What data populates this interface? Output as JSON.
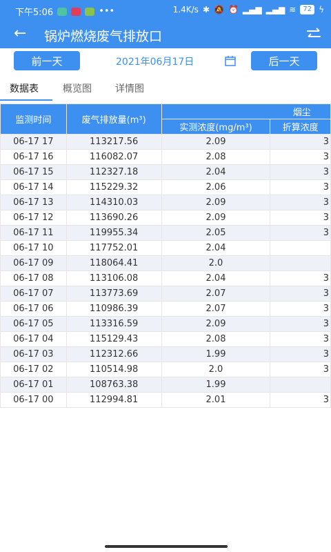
{
  "status": {
    "time": "下午5:06",
    "dots": "•••",
    "speed": "1.4K/s",
    "battery": "72"
  },
  "appbar": {
    "title": "锅炉燃烧废气排放口"
  },
  "datebar": {
    "prev": "前一天",
    "date": "2021年06月17日",
    "next": "后一天"
  },
  "tabs": [
    "数据表",
    "概览图",
    "详情图"
  ],
  "table": {
    "h_time": "监测时间",
    "h_flow": "废气排放量(m³)",
    "h_group": "烟尘",
    "h_measured": "实测浓度(mg/m³)",
    "h_converted": "折算浓度",
    "rows": [
      {
        "time": "06-17 17",
        "flow": "113217.56",
        "measured": "2.09",
        "conv": "3"
      },
      {
        "time": "06-17 16",
        "flow": "116082.07",
        "measured": "2.08",
        "conv": "3"
      },
      {
        "time": "06-17 15",
        "flow": "112327.18",
        "measured": "2.04",
        "conv": "3"
      },
      {
        "time": "06-17 14",
        "flow": "115229.32",
        "measured": "2.06",
        "conv": "3"
      },
      {
        "time": "06-17 13",
        "flow": "114310.03",
        "measured": "2.09",
        "conv": "3"
      },
      {
        "time": "06-17 12",
        "flow": "113690.26",
        "measured": "2.09",
        "conv": "3"
      },
      {
        "time": "06-17 11",
        "flow": "119955.34",
        "measured": "2.05",
        "conv": "3"
      },
      {
        "time": "06-17 10",
        "flow": "117752.01",
        "measured": "2.04",
        "conv": ""
      },
      {
        "time": "06-17 09",
        "flow": "118064.41",
        "measured": "2.0",
        "conv": ""
      },
      {
        "time": "06-17 08",
        "flow": "113106.08",
        "measured": "2.04",
        "conv": "3"
      },
      {
        "time": "06-17 07",
        "flow": "113773.69",
        "measured": "2.07",
        "conv": "3"
      },
      {
        "time": "06-17 06",
        "flow": "110986.39",
        "measured": "2.07",
        "conv": "3"
      },
      {
        "time": "06-17 05",
        "flow": "113316.59",
        "measured": "2.09",
        "conv": "3"
      },
      {
        "time": "06-17 04",
        "flow": "115129.43",
        "measured": "2.08",
        "conv": "3"
      },
      {
        "time": "06-17 03",
        "flow": "112312.66",
        "measured": "1.99",
        "conv": "3"
      },
      {
        "time": "06-17 02",
        "flow": "110514.98",
        "measured": "2.0",
        "conv": "3"
      },
      {
        "time": "06-17 01",
        "flow": "108763.38",
        "measured": "1.99",
        "conv": ""
      },
      {
        "time": "06-17 00",
        "flow": "112994.81",
        "measured": "2.01",
        "conv": "3"
      }
    ]
  }
}
